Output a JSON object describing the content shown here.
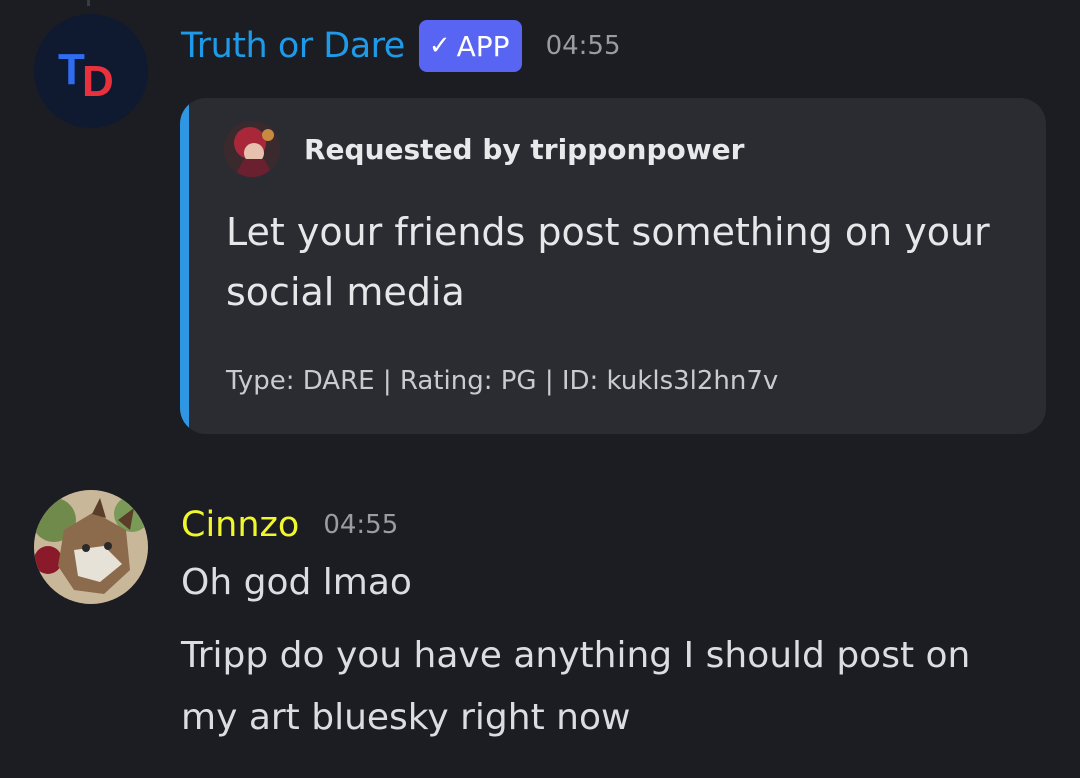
{
  "bot_message": {
    "avatar_letters": "TD",
    "username": "Truth or Dare",
    "badge": {
      "check": "✓",
      "label": "APP"
    },
    "timestamp": "04:55",
    "embed": {
      "author": "Requested by tripponpower",
      "description": "Let your friends post something on your social media",
      "footer": "Type: DARE | Rating: PG | ID: kukls3l2hn7v",
      "accent_color": "#2f96e3"
    }
  },
  "user_message": {
    "username": "Cinnzo",
    "username_color": "#f0f72c",
    "timestamp": "04:55",
    "lines": [
      "Oh god lmao",
      "Tripp do you have anything I should post on",
      "my art bluesky right now"
    ]
  }
}
